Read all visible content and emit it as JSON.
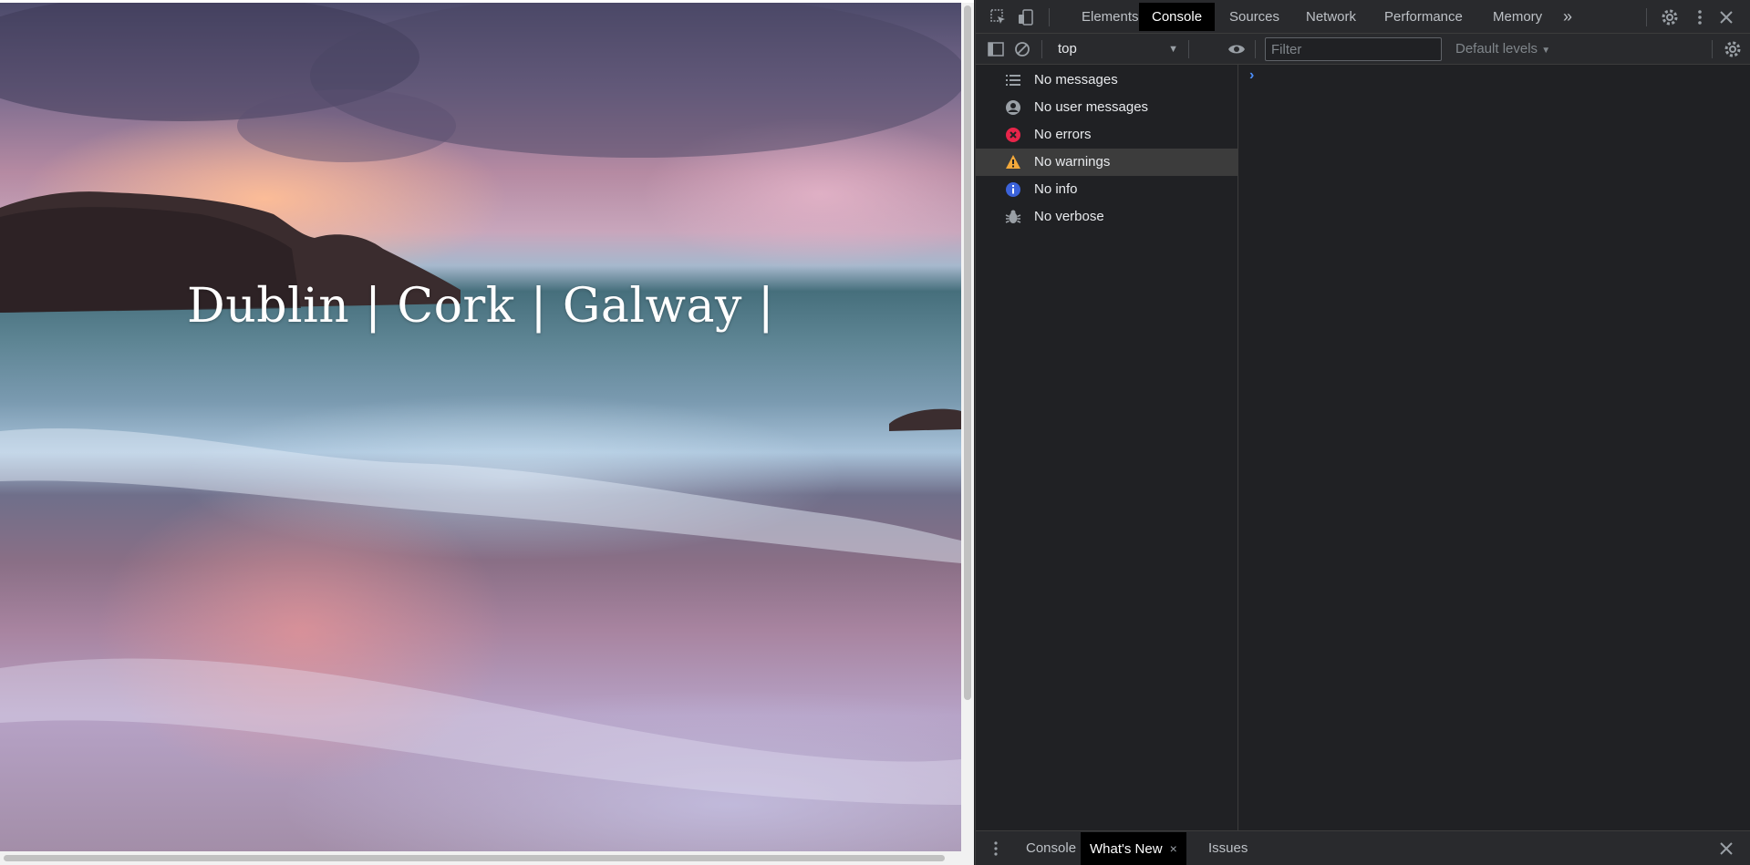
{
  "page": {
    "hero_title": "Dublin |  Cork |  Galway |"
  },
  "devtools": {
    "tabs": [
      {
        "label": "Elements"
      },
      {
        "label": "Console"
      },
      {
        "label": "Sources"
      },
      {
        "label": "Network"
      },
      {
        "label": "Performance"
      },
      {
        "label": "Memory"
      }
    ],
    "active_tab": "Console",
    "more_tabs_glyph": "»",
    "toolbar": {
      "context": "top",
      "filter_placeholder": "Filter",
      "levels_label": "Default levels"
    },
    "sidebar": [
      {
        "label": "No messages",
        "icon": "list-icon"
      },
      {
        "label": "No user messages",
        "icon": "user-icon"
      },
      {
        "label": "No errors",
        "icon": "error-icon",
        "color": "#e8254a"
      },
      {
        "label": "No warnings",
        "icon": "warning-icon",
        "color": "#f3a93b",
        "selected": true
      },
      {
        "label": "No info",
        "icon": "info-icon",
        "color": "#3b62d9"
      },
      {
        "label": "No verbose",
        "icon": "bug-icon"
      }
    ],
    "console_prompt": "›",
    "drawer": {
      "tabs": [
        {
          "label": "Console"
        },
        {
          "label": "What's New",
          "closable": true
        },
        {
          "label": "Issues"
        }
      ],
      "active_tab": "What's New",
      "close_glyph": "×"
    }
  },
  "colors": {
    "devtools_bg": "#202124",
    "toolbar_bg": "#292a2d",
    "active_tab_bg": "#000000",
    "accent_blue": "#4d90fe"
  }
}
